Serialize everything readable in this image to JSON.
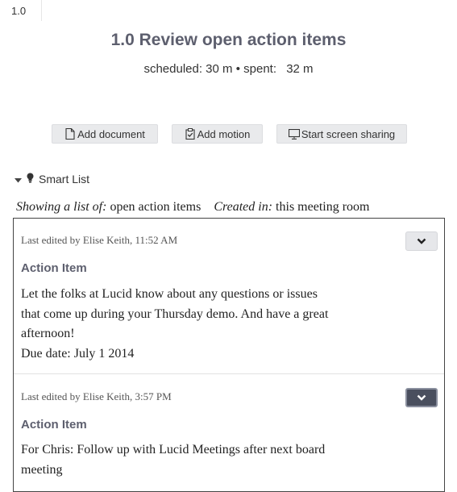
{
  "tab": {
    "label": "1.0"
  },
  "header": {
    "title": "1.0 Review open action items",
    "scheduled_label": "scheduled: 30 m",
    "separator": "•",
    "spent_label": "spent:",
    "spent_value": "32 m"
  },
  "buttons": {
    "add_document": "Add document",
    "add_motion": "Add motion",
    "screen_share": "Start screen sharing"
  },
  "smart_list": {
    "label": "Smart List",
    "showing_label": "Showing a list of:",
    "showing_value": "open action items",
    "created_label": "Created in:",
    "created_value": "this meeting room"
  },
  "items": [
    {
      "meta": "Last edited by Elise Keith, 11:52 AM",
      "type": "Action Item",
      "line1": "Let the folks at Lucid know about any questions or issues",
      "line2": "that come up during your Thursday demo.  And have a great",
      "line3": "afternoon!",
      "due": "Due date: July 1 2014"
    },
    {
      "meta": "Last edited by Elise Keith, 3:57 PM",
      "type": "Action Item",
      "line1": "For Chris: Follow up with Lucid Meetings after next board",
      "line2": "meeting"
    }
  ],
  "icons": {
    "document": "document-icon",
    "motion": "clipboard-check-icon",
    "screen": "monitor-icon",
    "caret": "caret-down-icon",
    "bulb": "lightbulb-icon",
    "chevron": "chevron-down-icon"
  }
}
